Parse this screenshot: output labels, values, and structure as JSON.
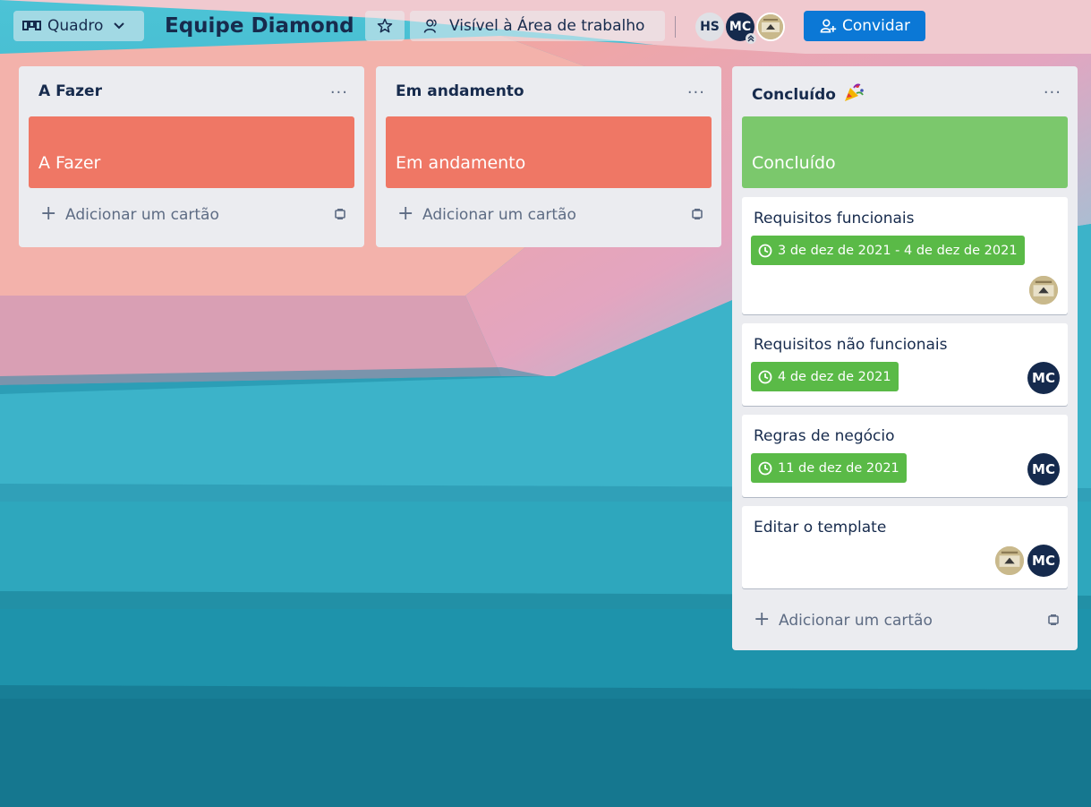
{
  "header": {
    "view_switcher_label": "Quadro",
    "board_title": "Equipe Diamond",
    "visibility_label": "Visível à Área de trabalho",
    "members": [
      {
        "initials": "HS"
      },
      {
        "initials": "MC"
      },
      {
        "initials": ""
      }
    ],
    "invite_label": "Convidar"
  },
  "colors": {
    "banner_red": "#ef7765",
    "banner_green": "#7bc86c",
    "badge_green": "#5aba47",
    "invite_blue": "#0b78d6",
    "avatar_navy": "#152a4d"
  },
  "lists": [
    {
      "title": "A Fazer",
      "menu_label": "...",
      "banner_text": "A Fazer",
      "add_label": "Adicionar um cartão"
    },
    {
      "title": "Em andamento",
      "menu_label": "...",
      "banner_text": "Em andamento",
      "add_label": "Adicionar um cartão"
    },
    {
      "title": "Concluído",
      "title_emoji_icon": "party-popper-icon",
      "menu_label": "...",
      "banner_text": "Concluído",
      "add_label": "Adicionar um cartão",
      "cards": [
        {
          "title": "Requisitos funcionais",
          "due": "3 de dez de 2021 - 4 de dez de 2021",
          "members": [
            "photo"
          ]
        },
        {
          "title": "Requisitos não funcionais",
          "due": "4 de dez de 2021",
          "members": [
            "MC"
          ]
        },
        {
          "title": "Regras de negócio",
          "due": "11 de dez de 2021",
          "members": [
            "MC"
          ]
        },
        {
          "title": "Editar o template",
          "members": [
            "photo",
            "MC"
          ]
        }
      ]
    }
  ]
}
